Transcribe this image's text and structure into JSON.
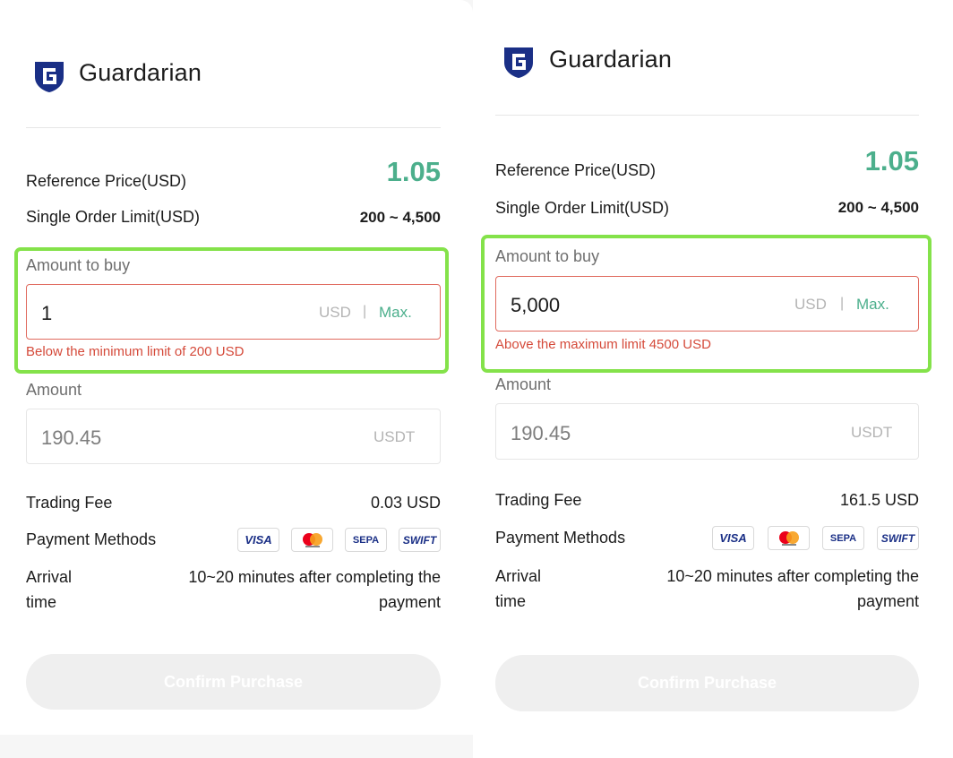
{
  "colors": {
    "accent_green": "#4caf8c",
    "error_red": "#d54a3a",
    "highlight_green": "#84e24a",
    "brand_navy": "#1a2f86"
  },
  "panels": [
    {
      "brand": "Guardarian",
      "reference_price_label": "Reference Price(USD)",
      "reference_price": "1.05",
      "order_limit_label": "Single Order Limit(USD)",
      "order_limit": "200 ~ 4,500",
      "amount_to_buy_label": "Amount to buy",
      "amount_to_buy_value": "1",
      "currency_unit": "USD",
      "separator": "|",
      "max_label": "Max.",
      "error_text": "Below the minimum limit of 200 USD",
      "amount_label": "Amount",
      "amount_value": "190.45",
      "amount_unit": "USDT",
      "fee_label": "Trading Fee",
      "fee_value": "0.03 USD",
      "payment_methods_label": "Payment Methods",
      "payment_methods": [
        "VISA",
        "mastercard",
        "SEPA",
        "SWIFT"
      ],
      "arrival_label_line1": "Arrival",
      "arrival_label_line2": "time",
      "arrival_value_line1": "10~20 minutes after completing the",
      "arrival_value_line2": "payment",
      "confirm_label": "Confirm Purchase"
    },
    {
      "brand": "Guardarian",
      "reference_price_label": "Reference Price(USD)",
      "reference_price": "1.05",
      "order_limit_label": "Single Order Limit(USD)",
      "order_limit": "200 ~ 4,500",
      "amount_to_buy_label": "Amount to buy",
      "amount_to_buy_value": "5,000",
      "currency_unit": "USD",
      "separator": "|",
      "max_label": "Max.",
      "error_text": "Above the maximum limit 4500 USD",
      "amount_label": "Amount",
      "amount_value": "190.45",
      "amount_unit": "USDT",
      "fee_label": "Trading Fee",
      "fee_value": "161.5 USD",
      "payment_methods_label": "Payment Methods",
      "payment_methods": [
        "VISA",
        "mastercard",
        "SEPA",
        "SWIFT"
      ],
      "arrival_label_line1": "Arrival",
      "arrival_label_line2": "time",
      "arrival_value_line1": "10~20 minutes after completing the",
      "arrival_value_line2": "payment",
      "confirm_label": "Confirm Purchase"
    }
  ]
}
